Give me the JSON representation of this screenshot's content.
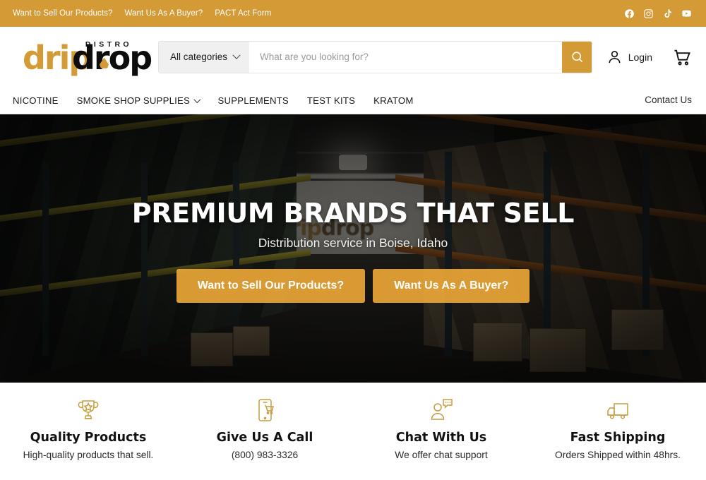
{
  "topbar": {
    "links": [
      {
        "label": "Want to Sell Our Products?"
      },
      {
        "label": "Want Us As A Buyer?"
      },
      {
        "label": "PACT Act Form"
      }
    ],
    "social": [
      {
        "name": "facebook-icon"
      },
      {
        "name": "instagram-icon"
      },
      {
        "name": "tiktok-icon"
      },
      {
        "name": "youtube-icon"
      }
    ],
    "background_color": "#d49a35"
  },
  "header": {
    "logo": {
      "distro": "DISTRO",
      "drip": "drip",
      "drop": "drop"
    },
    "search": {
      "category_label": "All categories",
      "placeholder": "What are you looking for?",
      "value": "",
      "button_icon": "search-icon",
      "button_color": "#d49a35"
    },
    "login_label": "Login",
    "cart_icon": "cart-icon"
  },
  "nav": {
    "items": [
      {
        "label": "NICOTINE",
        "has_dropdown": false
      },
      {
        "label": "SMOKE SHOP SUPPLIES",
        "has_dropdown": true
      },
      {
        "label": "SUPPLEMENTS",
        "has_dropdown": false
      },
      {
        "label": "TEST KITS",
        "has_dropdown": false
      },
      {
        "label": "KRATOM",
        "has_dropdown": false
      }
    ],
    "contact_label": "Contact Us"
  },
  "hero": {
    "title": "PREMIUM BRANDS THAT SELL",
    "subtitle": "Distribution service in Boise, Idaho",
    "wall_logo_a": "drip",
    "wall_logo_b": "drop",
    "buttons": [
      {
        "label": "Want to Sell Our Products?"
      },
      {
        "label": "Want Us As A Buyer?"
      }
    ],
    "button_color": "#e8a537"
  },
  "features": [
    {
      "icon": "trophy-icon",
      "title": "Quality Products",
      "text": "High-quality products that sell."
    },
    {
      "icon": "phone-cart-icon",
      "title": "Give Us A Call",
      "text": "(800) 983-3326"
    },
    {
      "icon": "chat-person-icon",
      "title": "Chat With Us",
      "text": "We offer chat support"
    },
    {
      "icon": "delivery-truck-icon",
      "title": "Fast Shipping",
      "text": "Orders Shipped within 48hrs."
    }
  ],
  "accent_color": "#d49a35"
}
